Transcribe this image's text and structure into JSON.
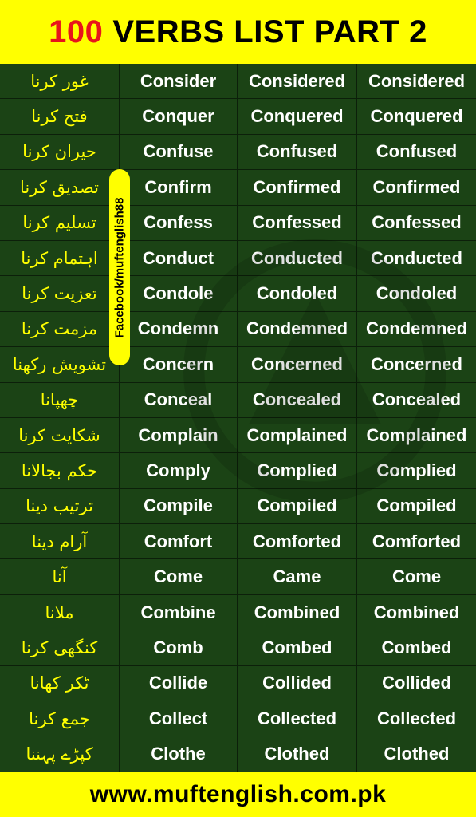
{
  "header": {
    "number": "100",
    "title": "VERBS LIST PART 2"
  },
  "badge": "Facebook/muftenglish88",
  "footer": "www.muftenglish.com.pk",
  "colors": {
    "header_bg": "#ffff00",
    "number": "#e8141b",
    "table_bg": "#1b4315",
    "urdu_text": "#ffff00",
    "english_text": "#ffffff"
  },
  "rows": [
    [
      "غور کرنا",
      "Consider",
      "Considered",
      "Considered"
    ],
    [
      "فتح کرنا",
      "Conquer",
      "Conquered",
      "Conquered"
    ],
    [
      "حیران کرنا",
      "Confuse",
      "Confused",
      "Confused"
    ],
    [
      "تصدیق کرنا",
      "Confirm",
      "Confirmed",
      "Confirmed"
    ],
    [
      "تسلیم کرنا",
      "Confess",
      "Confessed",
      "Confessed"
    ],
    [
      "اہتمام کرنا",
      "Conduct",
      "Conducted",
      "Conducted"
    ],
    [
      "تعزیت کرنا",
      "Condole",
      "Condoled",
      "Condoled"
    ],
    [
      "مزمت کرنا",
      "Condemn",
      "Condemned",
      "Condemned"
    ],
    [
      "تشویش رکھنا",
      "Concern",
      "Concerned",
      "Concerned"
    ],
    [
      "چھپانا",
      "Conceal",
      "Concealed",
      "Concealed"
    ],
    [
      "شکایت کرنا",
      "Complain",
      "Complained",
      "Complained"
    ],
    [
      "حکم بجالانا",
      "Comply",
      "Complied",
      "Complied"
    ],
    [
      "ترتیب دینا",
      "Compile",
      "Compiled",
      "Compiled"
    ],
    [
      "آرام دینا",
      "Comfort",
      "Comforted",
      "Comforted"
    ],
    [
      "آنا",
      "Come",
      "Came",
      "Come"
    ],
    [
      "ملانا",
      "Combine",
      "Combined",
      "Combined"
    ],
    [
      "کنگھی کرنا",
      "Comb",
      "Combed",
      "Combed"
    ],
    [
      "ٹکر کھانا",
      "Collide",
      "Collided",
      "Collided"
    ],
    [
      "جمع کرنا",
      "Collect",
      "Collected",
      "Collected"
    ],
    [
      "کپڑے پہننا",
      "Clothe",
      "Clothed",
      "Clothed"
    ]
  ]
}
